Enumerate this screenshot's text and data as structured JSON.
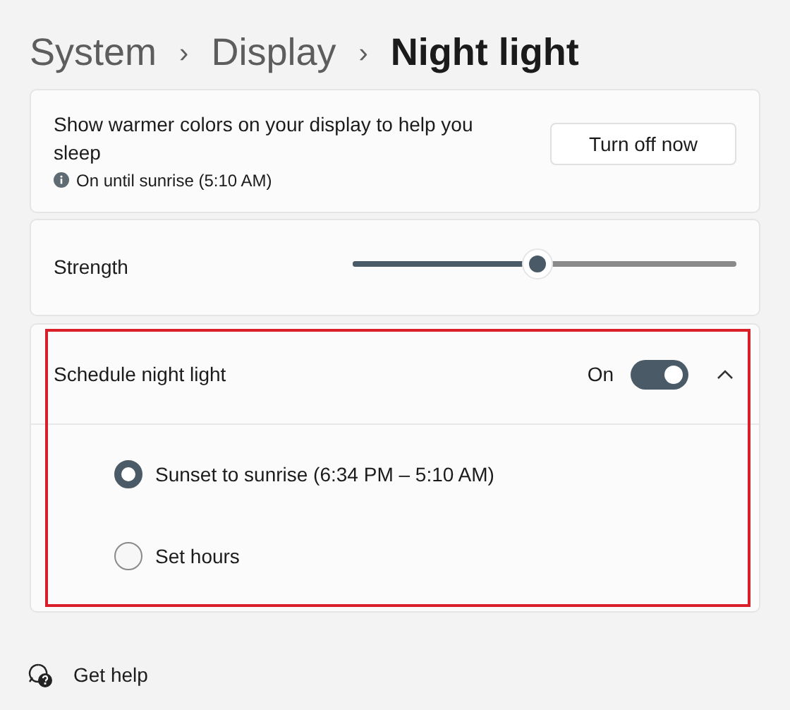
{
  "breadcrumb": [
    {
      "label": "System",
      "current": false
    },
    {
      "label": "›",
      "kind": "separator"
    },
    {
      "label": "Display",
      "current": false
    },
    {
      "label": "›",
      "kind": "separator"
    },
    {
      "label": "Night light",
      "current": true
    }
  ],
  "intro": {
    "description": "Show warmer colors on your display to help you sleep",
    "status": "On until sunrise (5:10 AM)",
    "button": "Turn off now"
  },
  "strength": {
    "label": "Strength",
    "level": 0.48
  },
  "schedule": {
    "label": "Schedule night light",
    "toggle_label": "On",
    "on": true,
    "expanded": true,
    "highlighted": true,
    "options": [
      {
        "label": "Sunset to sunrise (6:34 PM – 5:10 AM)",
        "selected": true
      },
      {
        "label": "Set hours",
        "selected": false
      }
    ]
  },
  "help": {
    "label": "Get help"
  }
}
